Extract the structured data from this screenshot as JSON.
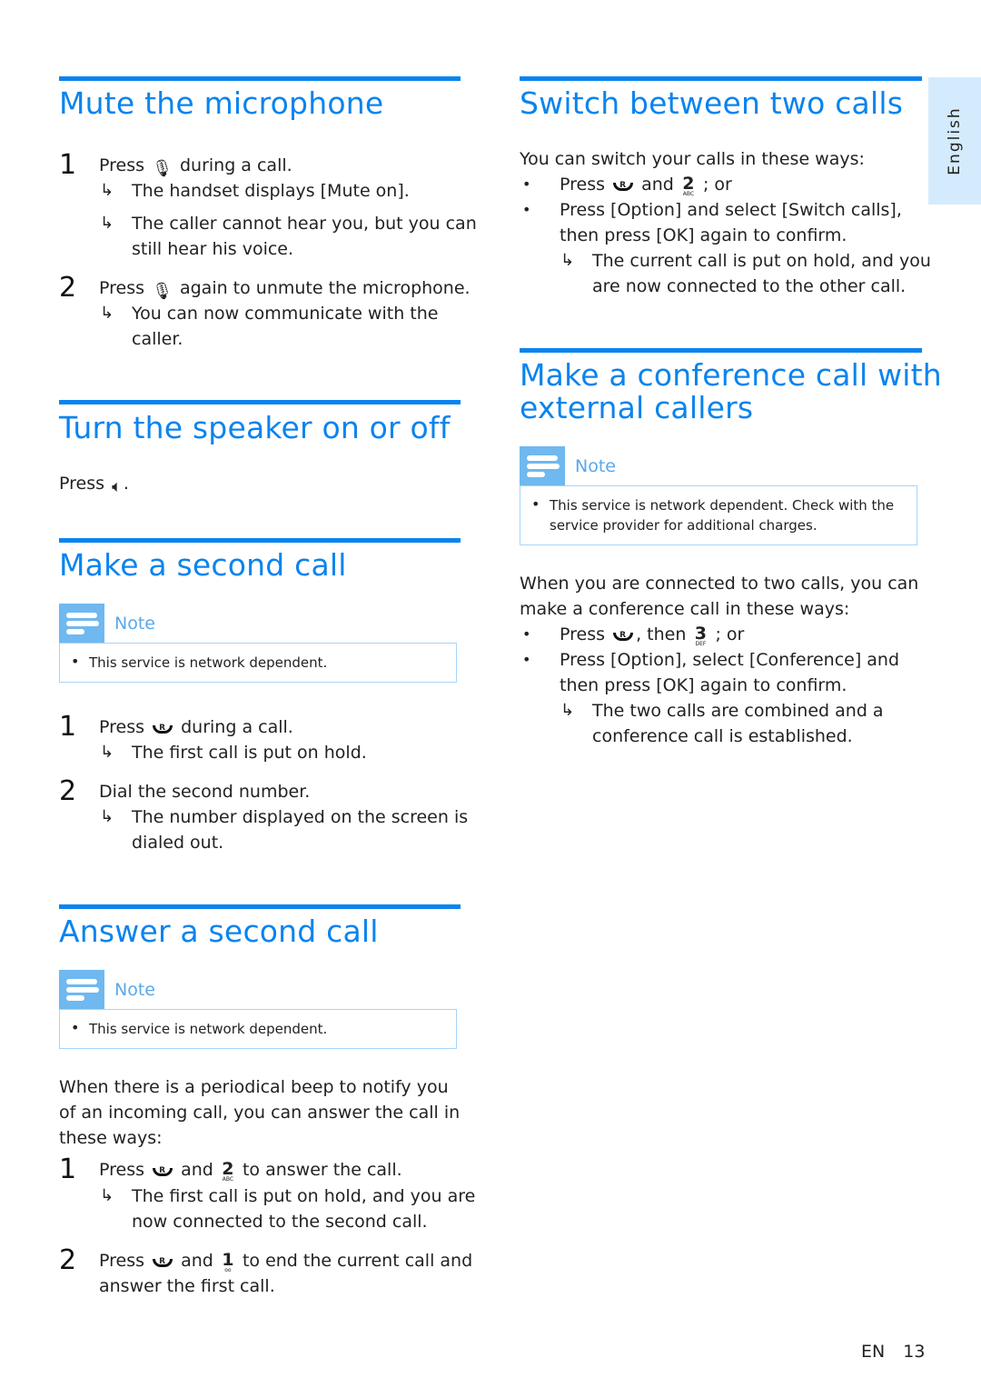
{
  "language_tab": "English",
  "footer": {
    "lang_code": "EN",
    "page_number": "13"
  },
  "colors": {
    "heading": "#0a84ee",
    "note_tag": "#6fb8f0",
    "note_border": "#a7d4f7",
    "lang_tab": "#d4ebfd"
  },
  "icons": {
    "mute": "mute-microphone-icon",
    "speaker": "speaker-icon",
    "recall": "recall-R-key-icon",
    "key2": "key-2-ABC-icon",
    "key3": "key-3-DEF-icon",
    "key1": "key-1-voicemail-icon"
  },
  "sections": {
    "mute": {
      "title": "Mute the microphone",
      "step1": {
        "num": "1",
        "pre": "Press",
        "post": "during a call.",
        "result1": "The handset displays [Mute on].",
        "result2a": "The caller cannot hear you, but you can",
        "result2b": "still hear his voice."
      },
      "step2": {
        "num": "2",
        "pre": "Press",
        "post": "again to unmute the microphone.",
        "result1a": "You can now communicate with the",
        "result1b": "caller."
      }
    },
    "speaker": {
      "title": "Turn the speaker on or off",
      "pre": "Press",
      "post": "."
    },
    "second_call": {
      "title": "Make a second call",
      "note_label": "Note",
      "note_text": "This service is network dependent.",
      "step1": {
        "num": "1",
        "pre": "Press",
        "post": "during a call.",
        "result": "The first call is put on hold."
      },
      "step2": {
        "num": "2",
        "text": "Dial the second number.",
        "result_a": "The number displayed on the screen is",
        "result_b": "dialed out."
      }
    },
    "answer": {
      "title": "Answer a second call",
      "note_label": "Note",
      "note_text": "This service is network dependent.",
      "intro_a": "When there is a periodical beep to notify you",
      "intro_b": "of an incoming call, you can answer the call in",
      "intro_c": "these ways:",
      "step1": {
        "num": "1",
        "pre": "Press",
        "mid": "and",
        "post": "to answer the call.",
        "result_a": "The first call is put on hold, and you are",
        "result_b": "now connected to the second call."
      },
      "step2": {
        "num": "2",
        "pre": "Press",
        "mid": "and",
        "post": "to end the current call and",
        "line2": "answer the first call."
      }
    },
    "switch": {
      "title": "Switch between two calls",
      "intro": "You can switch your calls in these ways:",
      "bullet1": {
        "pre": "Press",
        "mid": "and",
        "post": "; or"
      },
      "bullet2": {
        "line1": "Press [Option] and select [Switch calls],",
        "line2": "then press [OK] again to confirm.",
        "result_a": "The current call is put on hold, and you",
        "result_b": "are now connected to the other call."
      }
    },
    "conference": {
      "title_a": "Make a conference call with",
      "title_b": "external callers",
      "note_label": "Note",
      "note_text_a": "This service is network dependent. Check with the",
      "note_text_b": "service provider for additional charges.",
      "intro_a": "When you are connected to two calls, you can",
      "intro_b": "make a conference call in these ways:",
      "bullet1": {
        "pre": "Press",
        "mid": ", then",
        "post": "; or"
      },
      "bullet2": {
        "line1": "Press [Option], select [Conference] and",
        "line2": "then press [OK] again to confirm.",
        "result_a": "The two calls are combined and a",
        "result_b": "conference call is established."
      }
    }
  }
}
